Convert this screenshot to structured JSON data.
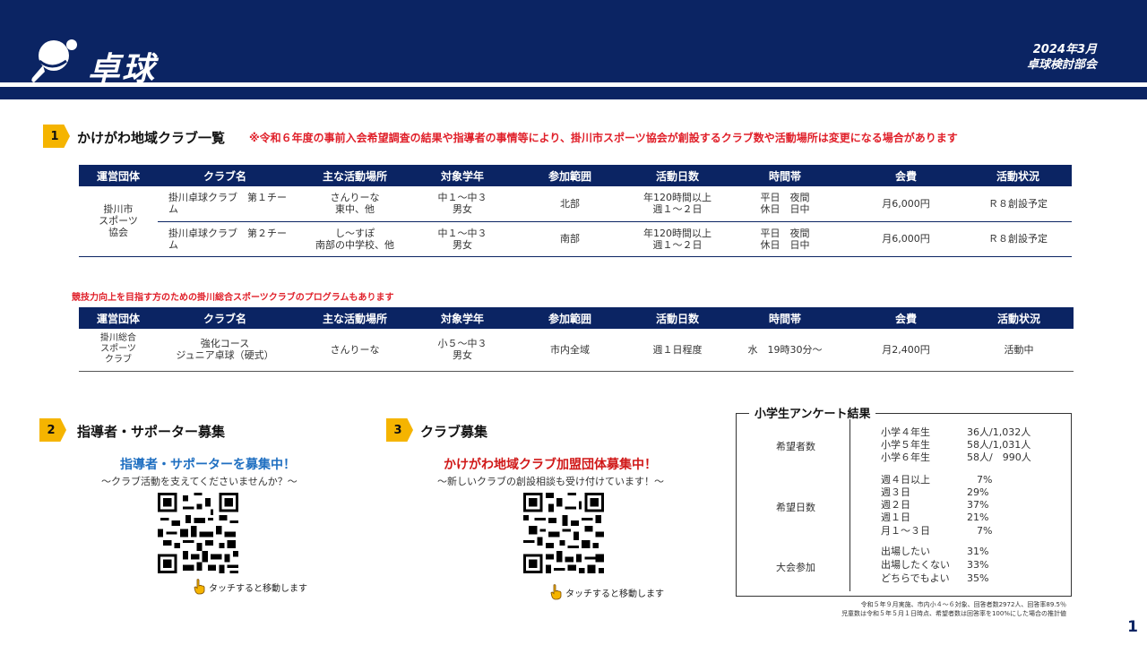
{
  "header": {
    "title": "卓球",
    "date": "2024年3月",
    "committee": "卓球検討部会"
  },
  "section1": {
    "number": "1",
    "title": "かけがわ地域クラブ一覧",
    "note": "※令和６年度の事前入会希望調査の結果や指導者の事情等により、掛川市スポーツ協会が創設するクラブ数や活動場所は変更になる場合があります"
  },
  "columns": [
    "運営団体",
    "クラブ名",
    "主な活動場所",
    "対象学年",
    "参加範囲",
    "活動日数",
    "時間帯",
    "会費",
    "活動状況"
  ],
  "table1": {
    "org": [
      "掛川市",
      "スポーツ",
      "協会"
    ],
    "rows": [
      {
        "name": "掛川卓球クラブ　第１チーム",
        "place": [
          "さんりーな",
          "東中、他"
        ],
        "grade": [
          "中１～中３",
          "男女"
        ],
        "range": "北部",
        "days": [
          "年120時間以上",
          "週１～２日"
        ],
        "time": [
          "平日　夜間",
          "休日　日中"
        ],
        "fee": "月6,000円",
        "status": "Ｒ８創設予定"
      },
      {
        "name": "掛川卓球クラブ　第２チーム",
        "place": [
          "し～すぽ",
          "南部の中学校、他"
        ],
        "grade": [
          "中１～中３",
          "男女"
        ],
        "range": "南部",
        "days": [
          "年120時間以上",
          "週１～２日"
        ],
        "time": [
          "平日　夜間",
          "休日　日中"
        ],
        "fee": "月6,000円",
        "status": "Ｒ８創設予定"
      }
    ]
  },
  "table2_note": "競技力向上を目指す方のための掛川総合スポーツクラブのプログラムもあります",
  "table2": {
    "org": [
      "掛川総合",
      "スポーツ",
      "クラブ"
    ],
    "name": [
      "強化コース",
      "ジュニア卓球（硬式）"
    ],
    "place": "さんりーな",
    "grade": [
      "小５～中３",
      "男女"
    ],
    "range": "市内全域",
    "days": "週１日程度",
    "time": "水　19時30分～",
    "fee": "月2,400円",
    "status": "活動中"
  },
  "section2": {
    "number": "2",
    "title": "指導者・サポーター募集",
    "headline": "指導者・サポーターを募集中！",
    "sub": "～クラブ活動を支えてくださいませんか？～",
    "touch": "タッチすると移動します"
  },
  "section3": {
    "number": "3",
    "title": "クラブ募集",
    "headline": "かけがわ地域クラブ加盟団体募集中！",
    "sub": "～新しいクラブの創設相談も受け付けています！～",
    "touch": "タッチすると移動します"
  },
  "survey": {
    "title": "小学生アンケート結果",
    "groups": [
      {
        "label": "希望者数",
        "rows": [
          {
            "k": "小学４年生",
            "v": "36人/1,032人"
          },
          {
            "k": "小学５年生",
            "v": "58人/1,031人"
          },
          {
            "k": "小学６年生",
            "v": "58人/　990人"
          }
        ]
      },
      {
        "label": "希望日数",
        "rows": [
          {
            "k": "週４日以上",
            "v": "　7%"
          },
          {
            "k": "週３日",
            "v": "29%"
          },
          {
            "k": "週２日",
            "v": "37%"
          },
          {
            "k": "週１日",
            "v": "21%"
          },
          {
            "k": "月１～３日",
            "v": "　7%"
          }
        ]
      },
      {
        "label": "大会参加",
        "rows": [
          {
            "k": "出場したい",
            "v": "31%"
          },
          {
            "k": "出場したくない",
            "v": "33%"
          },
          {
            "k": "どちらでもよい",
            "v": "35%"
          }
        ]
      }
    ],
    "footnote1": "令和５年９月実施、市内小４～６対象、回答者数2972人、回答率89.5％",
    "footnote2": "児童数は令和５年５月１日時点、希望者数は回答率を100%にした場合の推計値"
  },
  "page_number": "1",
  "colors": {
    "navy": "#0b2463",
    "accent": "#f5b400",
    "red": "#e0202a",
    "blue": "#1f6fc1"
  }
}
